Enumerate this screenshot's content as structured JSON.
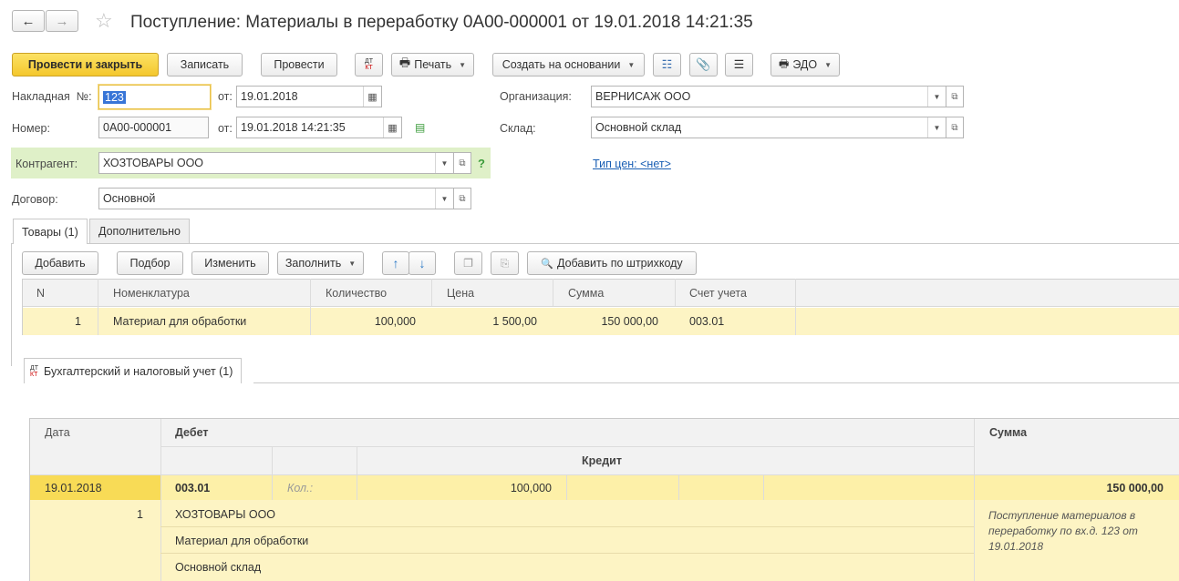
{
  "header": {
    "back_icon": "arrow-left-icon",
    "forward_icon": "arrow-right-icon",
    "star_icon": "star-icon",
    "title": "Поступление: Материалы в переработку 0А00-000001 от 19.01.2018 14:21:35"
  },
  "toolbar": {
    "post_close": "Провести и закрыть",
    "save": "Записать",
    "post": "Провести",
    "dtkt_icon": "ДТ КТ",
    "print": "Печать",
    "create_based": "Создать на основании",
    "edo": "ЭДО"
  },
  "form": {
    "invoice_label": "Накладная  №:",
    "invoice_value": "123",
    "from_label": "от:",
    "invoice_date": "19.01.2018",
    "number_label": "Номер:",
    "number_value": "0А00-000001",
    "number_date": "19.01.2018 14:21:35",
    "org_label": "Организация:",
    "org_value": "ВЕРНИСАЖ ООО",
    "warehouse_label": "Склад:",
    "warehouse_value": "Основной склад",
    "counterparty_label": "Контрагент:",
    "counterparty_value": "ХОЗТОВАРЫ ООО",
    "help_mark": "?",
    "price_type_link": "Тип цен: <нет>",
    "contract_label": "Договор:",
    "contract_value": "Основной"
  },
  "tabs": {
    "goods": "Товары (1)",
    "additional": "Дополнительно"
  },
  "goods_toolbar": {
    "add": "Добавить",
    "pick": "Подбор",
    "edit": "Изменить",
    "fill": "Заполнить",
    "barcode": "Добавить по штрихкоду"
  },
  "goods_table": {
    "columns": [
      "N",
      "Номенклатура",
      "Количество",
      "Цена",
      "Сумма",
      "Счет учета"
    ],
    "rows": [
      {
        "n": "1",
        "item": "Материал для обработки",
        "qty": "100,000",
        "price": "1 500,00",
        "sum": "150 000,00",
        "account": "003.01"
      }
    ]
  },
  "accounting_tab": {
    "icon": "ДТ КТ",
    "label": "Бухгалтерский и налоговый учет (1)"
  },
  "accounting_table": {
    "col_date": "Дата",
    "col_debit": "Дебет",
    "col_credit": "Кредит",
    "col_sum": "Сумма",
    "row": {
      "date": "19.01.2018",
      "num": "1",
      "debit_account": "003.01",
      "qty_label": "Кол.:",
      "qty": "100,000",
      "sum": "150 000,00",
      "sub1": "ХОЗТОВАРЫ ООО",
      "sub2": "Материал для обработки",
      "sub3": "Основной склад",
      "comment": "Поступление материалов в переработку по вх.д. 123 от 19.01.2018"
    }
  },
  "colors": {
    "primary_button": "#f4c72d",
    "row_highlight": "#fdf4c4",
    "counterparty_bg": "#dff0c8",
    "link": "#1a5fb4"
  }
}
